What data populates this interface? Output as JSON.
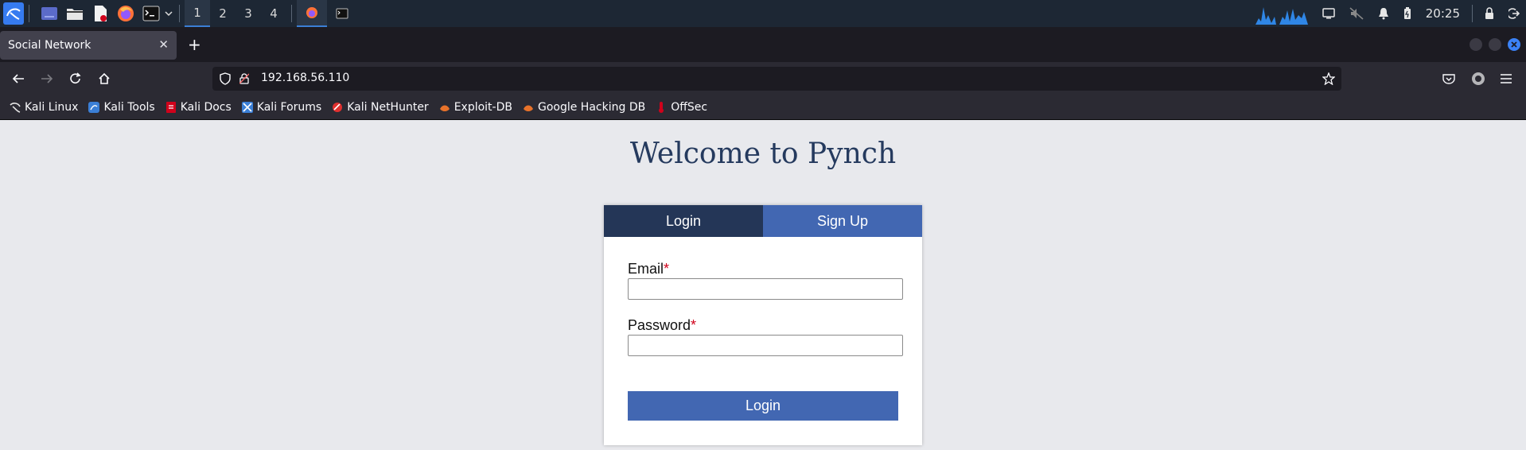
{
  "taskbar": {
    "workspaces": [
      "1",
      "2",
      "3",
      "4"
    ],
    "active_workspace": "1",
    "clock": "20:25"
  },
  "browser": {
    "tab_title": "Social Network",
    "tab_close": "✕",
    "new_tab": "+",
    "url": "192.168.56.110"
  },
  "bookmarks": [
    {
      "label": "Kali Linux",
      "icon": "kali-dragon-icon",
      "color": "#111111"
    },
    {
      "label": "Kali Tools",
      "icon": "kali-tools-icon",
      "color": "#3b7fd6"
    },
    {
      "label": "Kali Docs",
      "icon": "kali-docs-icon",
      "color": "#d0021b"
    },
    {
      "label": "Kali Forums",
      "icon": "kali-forums-icon",
      "color": "#3b7fd6"
    },
    {
      "label": "Kali NetHunter",
      "icon": "nethunter-icon",
      "color": "#e0302f"
    },
    {
      "label": "Exploit-DB",
      "icon": "exploit-db-icon",
      "color": "#e8722a"
    },
    {
      "label": "Google Hacking DB",
      "icon": "ghdb-icon",
      "color": "#e8722a"
    },
    {
      "label": "OffSec",
      "icon": "offsec-icon",
      "color": "#d0021b"
    }
  ],
  "page": {
    "heading": "Welcome to Pynch",
    "tabs": {
      "login": "Login",
      "signup": "Sign Up"
    },
    "email_label": "Email",
    "password_label": "Password",
    "required_mark": "*",
    "submit_label": "Login"
  },
  "colors": {
    "primary_dark": "#243657",
    "primary": "#4267b2",
    "heading": "#253a5e",
    "required": "#d0021b"
  }
}
